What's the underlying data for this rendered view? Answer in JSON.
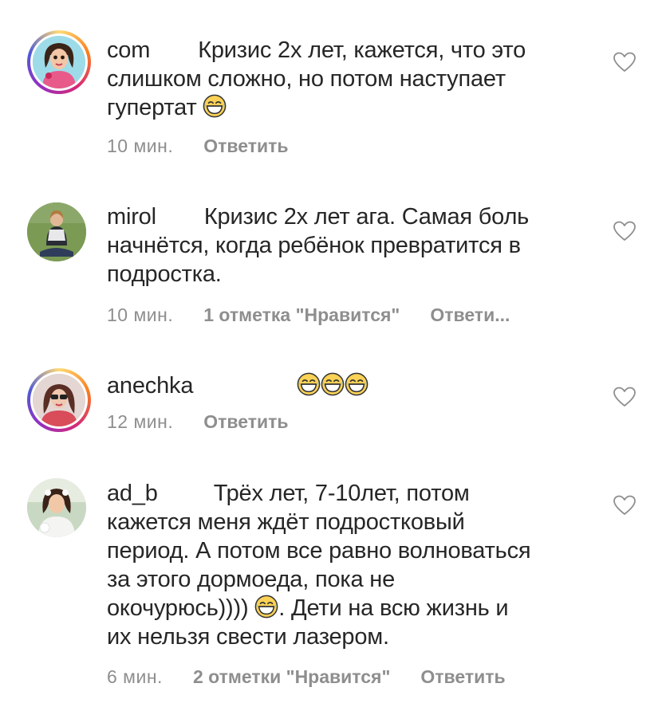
{
  "comments": [
    {
      "username": "com",
      "text_lines": [
        "Кризис 2х лет, кажется, что это",
        "слишком сложно, но потом наступает",
        "гупертат"
      ],
      "time": "10 мин.",
      "likes": "",
      "reply": "Ответить",
      "avatar": "cartoon-woman-avatar"
    },
    {
      "username": "mirol",
      "text_lines": [
        "Кризис 2х лет ага. Самая боль",
        "начнётся, когда ребёнок превратится в",
        "подростка."
      ],
      "time": "10 мин.",
      "likes": "1 отметка \"Нравится\"",
      "reply": "Ответи...",
      "avatar": "woman-sitting-grass-avatar"
    },
    {
      "username": "anechka",
      "text_lines": [
        ""
      ],
      "time": "12 мин.",
      "likes": "",
      "reply": "Ответить",
      "avatar": "woman-sunglasses-avatar"
    },
    {
      "username": "ad_b",
      "text_lines": [
        "Трёх лет, 7-10лет, потом",
        "кажется меня ждёт подростковый",
        "период. А потом все равно волноваться",
        "за этого дормоеда, пока не",
        "окочурюсь))))",
        ". Дети на всю жизнь и",
        "их нельзя свести лазером."
      ],
      "time": "6 мин.",
      "likes": "2 отметки \"Нравится\"",
      "reply": "Ответить",
      "avatar": "bride-avatar"
    }
  ],
  "icons": {
    "like": "heart-outline-icon",
    "emoji": "laughing-tears-emoji"
  },
  "colors": {
    "text": "#262626",
    "meta": "#8e8e8e"
  }
}
